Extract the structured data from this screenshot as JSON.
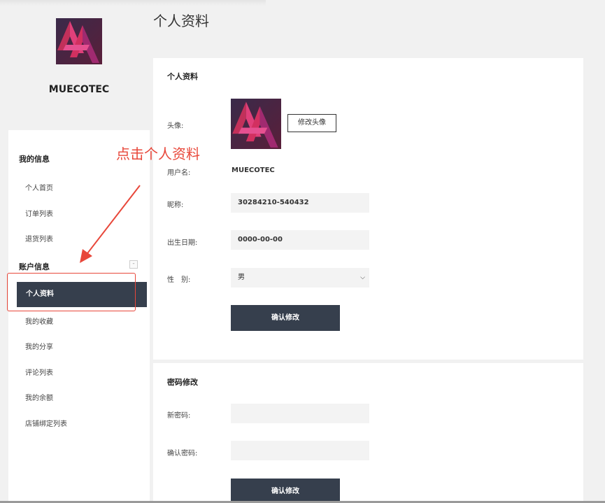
{
  "profile": {
    "name": "MUECOTEC",
    "avatar_icon": "brand-logo-icon"
  },
  "sidebar": {
    "section_my_info": "我的信息",
    "items_my_info": [
      "个人首页",
      "订单列表",
      "退货列表"
    ],
    "section_account": "账户信息",
    "active_item": "个人资料",
    "items_account": [
      "我的收藏",
      "我的分享",
      "评论列表",
      "我的余额",
      "店铺绑定列表"
    ],
    "collapse_symbol": "-"
  },
  "annotation": {
    "text": "点击个人资料",
    "color": "#e8473a"
  },
  "page": {
    "title": "个人资料"
  },
  "profile_panel": {
    "title": "个人资料",
    "avatar_label": "头像:",
    "change_avatar_button": "修改头像",
    "username_label": "用户名:",
    "username_value": "MUECOTEC",
    "nickname_label": "昵称:",
    "nickname_value": "30284210-540432",
    "birthday_label": "出生日期:",
    "birthday_value": "0000-00-00",
    "gender_label": "性　别:",
    "gender_value": "男",
    "confirm_button": "确认修改"
  },
  "password_panel": {
    "title": "密码修改",
    "new_password_label": "新密码:",
    "new_password_value": "",
    "confirm_password_label": "确认密码:",
    "confirm_password_value": "",
    "confirm_button": "确认修改"
  },
  "colors": {
    "accent_dark": "#363f4d",
    "annotation_red": "#e8473a",
    "background": "#f1f1f1"
  }
}
